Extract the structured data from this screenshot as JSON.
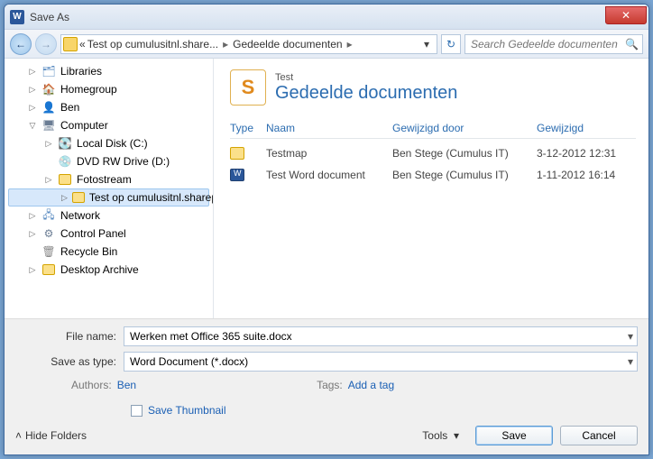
{
  "window": {
    "title": "Save As",
    "word_glyph": "W",
    "close_glyph": "✕"
  },
  "nav": {
    "back_glyph": "←",
    "fwd_glyph": "→",
    "refresh_glyph": "↻"
  },
  "breadcrumb": {
    "prefix": "«",
    "seg1": "Test op cumulusitnl.share...",
    "seg2": "Gedeelde documenten",
    "arrow": "▸",
    "dd": "▾"
  },
  "search": {
    "placeholder": "Search Gedeelde documenten",
    "icon": "🔍"
  },
  "tree": {
    "libraries": "Libraries",
    "homegroup": "Homegroup",
    "ben": "Ben",
    "computer": "Computer",
    "localc": "Local Disk (C:)",
    "dvd": "DVD RW Drive (D:)",
    "fotostream": "Fotostream",
    "sharepoint": "Test op cumulusitnl.sharepoint",
    "network": "Network",
    "cp": "Control Panel",
    "recycle": "Recycle Bin",
    "desktop": "Desktop Archive",
    "exp_right": "▷",
    "exp_down": "▽",
    "exp_none": ""
  },
  "content": {
    "pre": "Test",
    "title": "Gedeelde documenten",
    "sp_glyph": "S",
    "cols": {
      "type": "Type",
      "naam": "Naam",
      "door": "Gewijzigd door",
      "gew": "Gewijzigd"
    },
    "rows": [
      {
        "icon": "folder",
        "naam": "Testmap",
        "door": "Ben Stege (Cumulus IT)",
        "gew": "3-12-2012 12:31"
      },
      {
        "icon": "word",
        "naam": "Test Word document",
        "door": "Ben Stege (Cumulus IT)",
        "gew": "1-11-2012 16:14"
      }
    ]
  },
  "fields": {
    "filename_label": "File name:",
    "filename": "Werken met Office 365 suite.docx",
    "type_label": "Save as type:",
    "type": "Word Document (*.docx)",
    "dd": "▾"
  },
  "meta": {
    "authors_lbl": "Authors:",
    "authors": "Ben",
    "tags_lbl": "Tags:",
    "tags": "Add a tag"
  },
  "thumb": {
    "label": "Save Thumbnail"
  },
  "actions": {
    "hide": "Hide Folders",
    "hide_glyph": "˄",
    "tools": "Tools",
    "tools_dd": "▾",
    "save": "Save",
    "cancel": "Cancel"
  }
}
